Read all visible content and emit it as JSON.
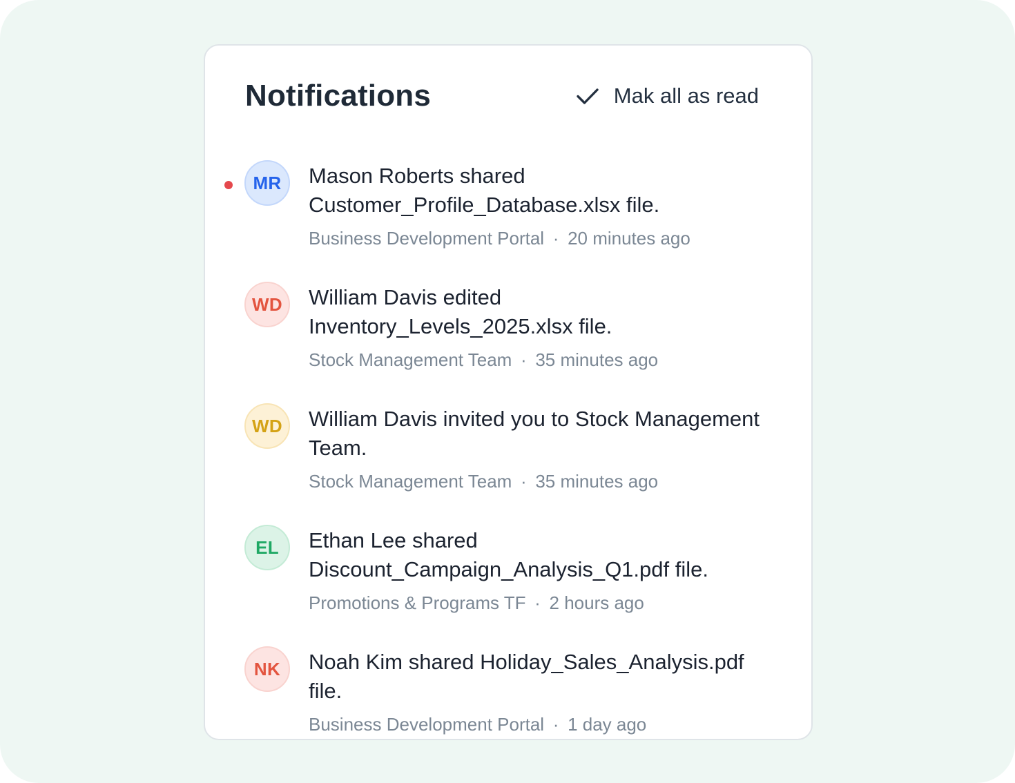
{
  "header": {
    "title": "Notifications",
    "mark_all_label": "Mak all as read"
  },
  "notifications": [
    {
      "initials": "MR",
      "unread": true,
      "message": "Mason Roberts shared Customer_Profile_Database.xlsx file.",
      "source": "Business Development Portal",
      "time": "20 minutes ago",
      "colors": {
        "bg": "#dbe8fd",
        "border": "#c3d7fb",
        "text": "#2563eb"
      }
    },
    {
      "initials": "WD",
      "unread": false,
      "message": "William Davis edited Inventory_Levels_2025.xlsx file.",
      "source": "Stock Management Team",
      "time": "35 minutes ago",
      "colors": {
        "bg": "#fde4e2",
        "border": "#f9d3cf",
        "text": "#e3543f"
      }
    },
    {
      "initials": "WD",
      "unread": false,
      "message": "William Davis invited you to Stock Management Team.",
      "source": "Stock Management Team",
      "time": "35 minutes ago",
      "colors": {
        "bg": "#fdf1d6",
        "border": "#f8e4b5",
        "text": "#d4a215"
      }
    },
    {
      "initials": "EL",
      "unread": false,
      "message": "Ethan Lee shared Discount_Campaign_Analysis_Q1.pdf file.",
      "source": "Promotions & Programs TF",
      "time": "2 hours ago",
      "colors": {
        "bg": "#dcf3e7",
        "border": "#c4ebd6",
        "text": "#1fa864"
      }
    },
    {
      "initials": "NK",
      "unread": false,
      "message": "Noah Kim shared Holiday_Sales_Analysis.pdf file.",
      "source": "Business Development Portal",
      "time": "1 day ago",
      "colors": {
        "bg": "#fde4e2",
        "border": "#f9d3cf",
        "text": "#e3543f"
      }
    }
  ],
  "meta_separator": "·"
}
